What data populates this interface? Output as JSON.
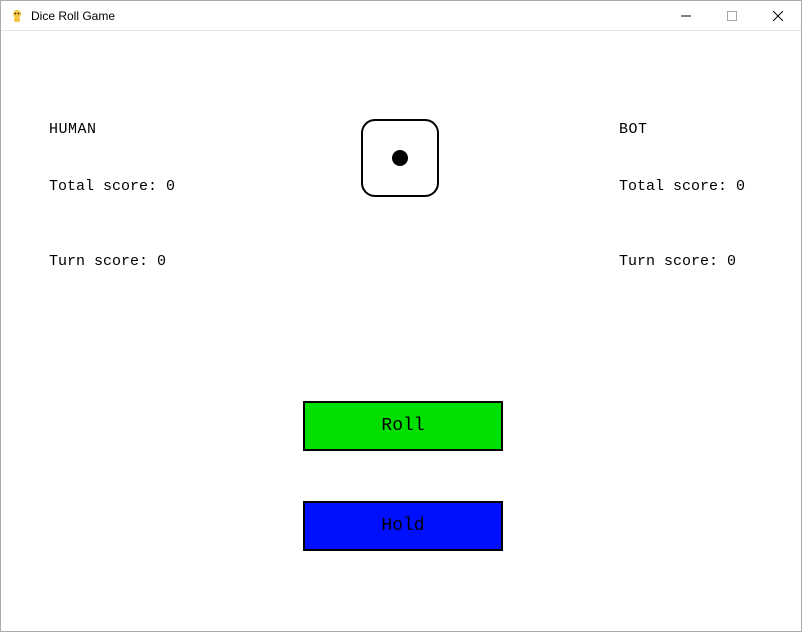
{
  "window": {
    "title": "Dice Roll Game"
  },
  "human": {
    "label": "HUMAN",
    "total_score_label": "Total score:",
    "total_score": 0,
    "turn_score_label": "Turn score:",
    "turn_score": 0
  },
  "bot": {
    "label": "BOT",
    "total_score_label": "Total score:",
    "total_score": 0,
    "turn_score_label": "Turn score:",
    "turn_score": 0
  },
  "die": {
    "value": 1
  },
  "buttons": {
    "roll": "Roll",
    "hold": "Hold"
  },
  "colors": {
    "roll_bg": "#00e000",
    "hold_bg": "#0010ff"
  }
}
